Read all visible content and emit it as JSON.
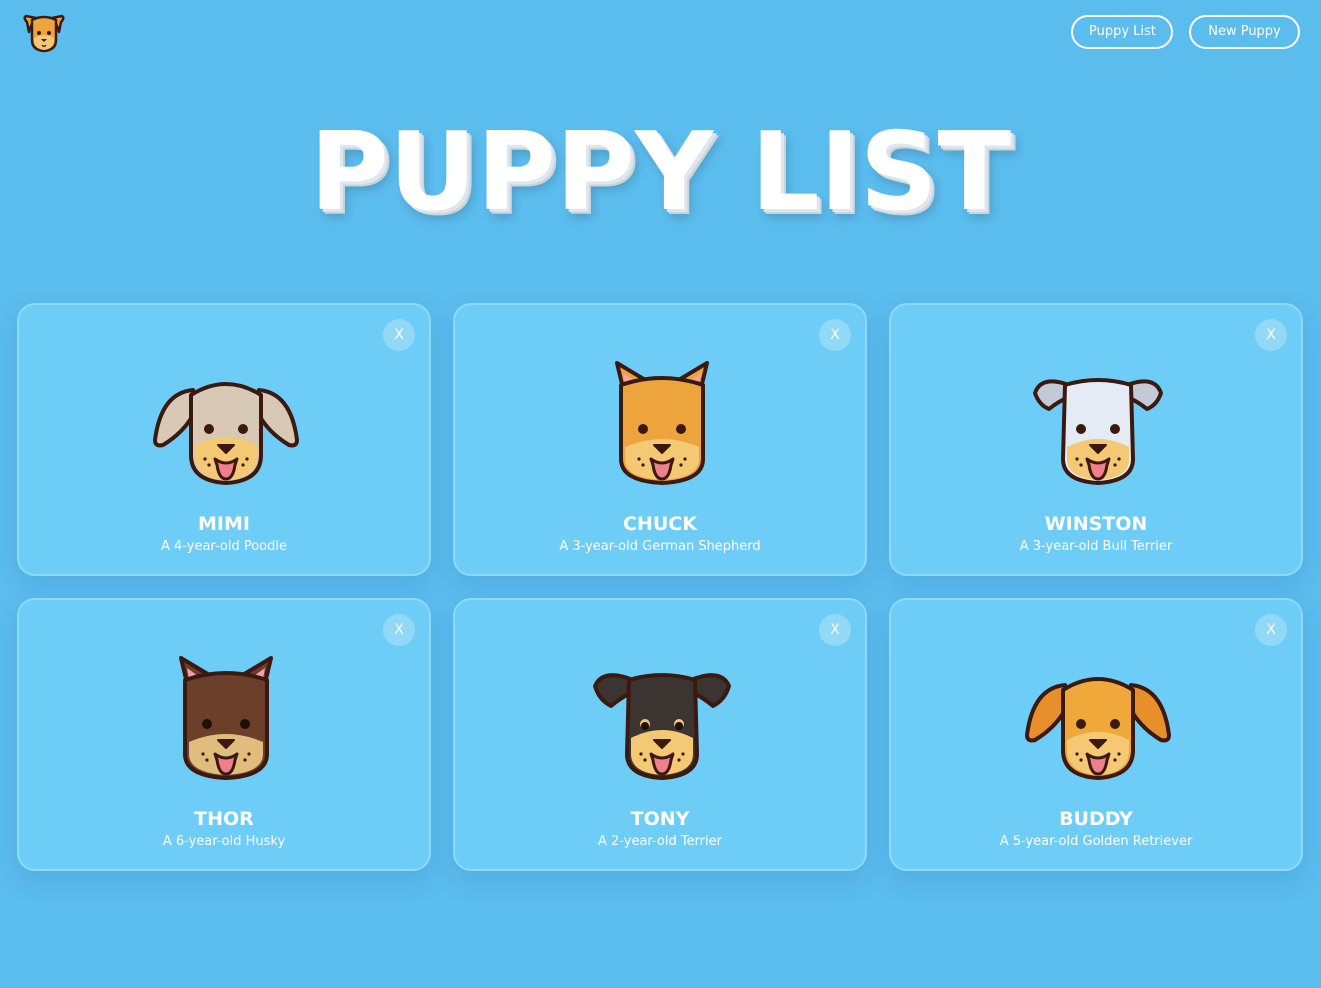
{
  "nav": {
    "puppy_list_label": "Puppy List",
    "new_puppy_label": "New Puppy"
  },
  "page": {
    "title": "PUPPY LIST"
  },
  "puppies": [
    {
      "name": "MIMI",
      "description": "A 4-year-old Poodle",
      "icon": "poodle-face-icon",
      "colors": {
        "fur": "#d8c9b6",
        "ears": "#d8c9b6",
        "muzzle": "#f5c873"
      }
    },
    {
      "name": "CHUCK",
      "description": "A 3-year-old German Shepherd",
      "icon": "german-shepherd-face-icon",
      "colors": {
        "fur": "#eea43c",
        "ears": "#eea43c",
        "muzzle": "#f5c873"
      }
    },
    {
      "name": "WINSTON",
      "description": "A 3-year-old Bull Terrier",
      "icon": "bull-terrier-face-icon",
      "colors": {
        "fur": "#e4ebf4",
        "ears": "#c3cad6",
        "muzzle": "#f5c873"
      }
    },
    {
      "name": "THOR",
      "description": "A 6-year-old Husky",
      "icon": "husky-face-icon",
      "colors": {
        "fur": "#6b3f2a",
        "ears": "#6b3f2a",
        "muzzle": "#e0bd7c"
      }
    },
    {
      "name": "TONY",
      "description": "A 2-year-old Terrier",
      "icon": "terrier-face-icon",
      "colors": {
        "fur": "#3b3430",
        "ears": "#3b3430",
        "muzzle": "#f5c873"
      }
    },
    {
      "name": "BUDDY",
      "description": "A 5-year-old Golden Retriever",
      "icon": "golden-retriever-face-icon",
      "colors": {
        "fur": "#f0a83a",
        "ears": "#e88e2a",
        "muzzle": "#f5c873"
      }
    }
  ],
  "card_close_label": "X",
  "colors": {
    "background": "#5bbcee",
    "card": "#6ecdf6",
    "text": "#ffffff"
  }
}
